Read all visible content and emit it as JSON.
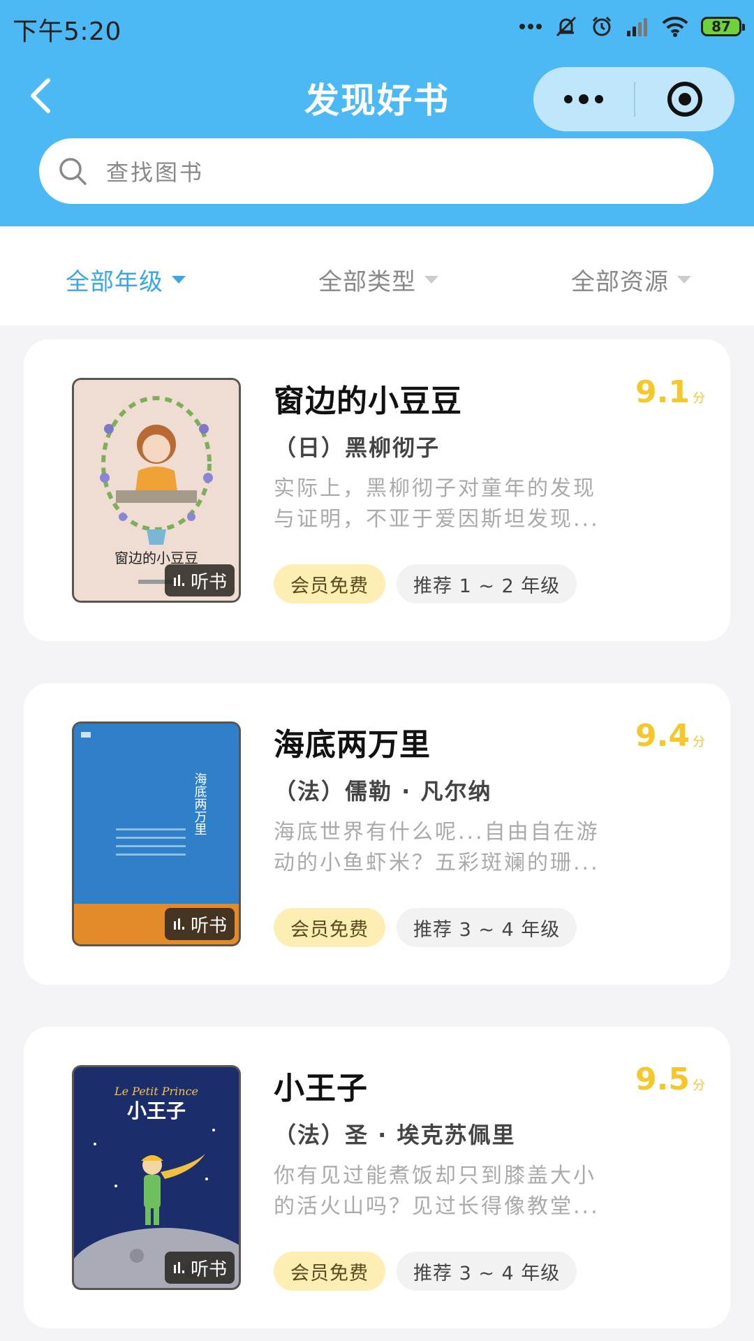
{
  "status": {
    "time": "下午5:20",
    "battery": "87"
  },
  "nav": {
    "title": "发现好书"
  },
  "search": {
    "placeholder": "查找图书"
  },
  "filters": [
    {
      "label": "全部年级",
      "active": true
    },
    {
      "label": "全部类型",
      "active": false
    },
    {
      "label": "全部资源",
      "active": false
    }
  ],
  "books": [
    {
      "title": "窗边的小豆豆",
      "score": "9.1",
      "score_unit": "分",
      "author": "（日）黑柳彻子",
      "desc_line1": "实际上，黑柳彻子对童年的发现",
      "desc_line2": "与证明，不亚于爱因斯坦发现...",
      "tag_vip": "会员免费",
      "tag_grade": "推荐 1 ~ 2 年级",
      "listen": "听书",
      "cover_title": "窗边的小豆豆"
    },
    {
      "title": "海底两万里",
      "score": "9.4",
      "score_unit": "分",
      "author": "（法）儒勒 · 凡尔纳",
      "desc_line1": "海底世界有什么呢...自由自在游",
      "desc_line2": "动的小鱼虾米？五彩斑斓的珊...",
      "tag_vip": "会员免费",
      "tag_grade": "推荐 3 ~ 4 年级",
      "listen": "听书",
      "cover_title": "海底两万里"
    },
    {
      "title": "小王子",
      "score": "9.5",
      "score_unit": "分",
      "author": "（法）圣 · 埃克苏佩里",
      "desc_line1": "你有见过能煮饭却只到膝盖大小",
      "desc_line2": "的活火山吗？见过长得像教堂...",
      "tag_vip": "会员免费",
      "tag_grade": "推荐 3 ~ 4 年级",
      "listen": "听书",
      "cover_title": "小王子",
      "cover_subtitle": "Le Petit Prince"
    }
  ],
  "colors": {
    "header": "#4cb8f4",
    "accent": "#3aa6e6",
    "score": "#f6c72a"
  }
}
